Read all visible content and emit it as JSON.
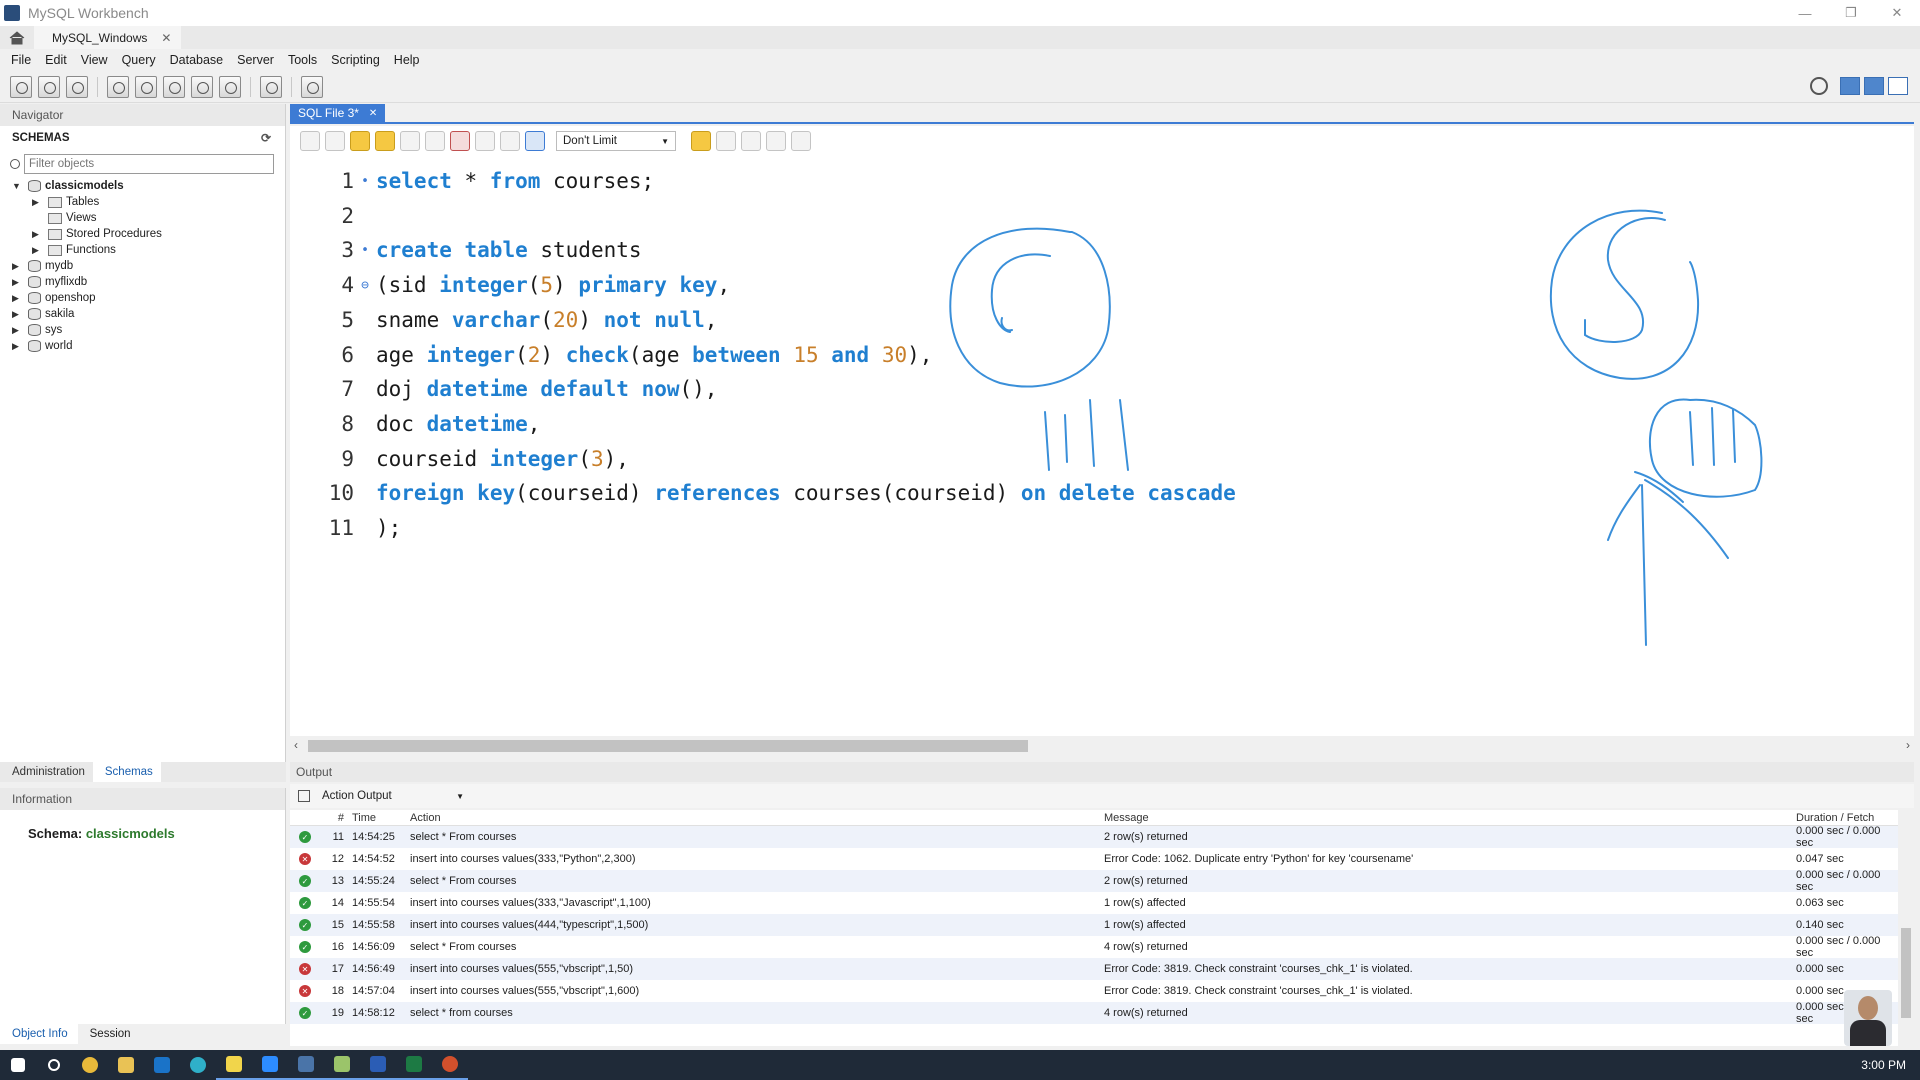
{
  "window": {
    "title": "MySQL Workbench",
    "minimize": "—",
    "restore": "❐",
    "close": "✕"
  },
  "connection_tab": {
    "label": "MySQL_Windows",
    "close": "✕"
  },
  "menu": [
    "File",
    "Edit",
    "View",
    "Query",
    "Database",
    "Server",
    "Tools",
    "Scripting",
    "Help"
  ],
  "navigator": {
    "title": "Navigator",
    "schemas_label": "SCHEMAS",
    "filter_placeholder": "Filter objects",
    "tree": [
      {
        "name": "classicmodels",
        "expanded": true,
        "children": [
          "Tables",
          "Views",
          "Stored Procedures",
          "Functions"
        ]
      },
      {
        "name": "mydb"
      },
      {
        "name": "myflixdb"
      },
      {
        "name": "openshop"
      },
      {
        "name": "sakila"
      },
      {
        "name": "sys"
      },
      {
        "name": "world"
      }
    ]
  },
  "admin_tabs": [
    "Administration",
    "Schemas"
  ],
  "information": {
    "title": "Information",
    "schema_label": "Schema:",
    "schema_value": "classicmodels"
  },
  "bottom_tabs": [
    "Object Info",
    "Session"
  ],
  "editor": {
    "tab_label": "SQL File 3*",
    "tab_close": "✕",
    "limit": "Don't Limit",
    "lines": [
      {
        "n": "1",
        "marker": "•",
        "text": "select * from courses;"
      },
      {
        "n": "2",
        "marker": "",
        "text": ""
      },
      {
        "n": "3",
        "marker": "•",
        "text": "create table students"
      },
      {
        "n": "4",
        "marker": "⊖",
        "text": "(sid integer(5) primary key,"
      },
      {
        "n": "5",
        "marker": "",
        "text": "sname varchar(20) not null,"
      },
      {
        "n": "6",
        "marker": "",
        "text": "age integer(2) check(age between 15 and 30),"
      },
      {
        "n": "7",
        "marker": "",
        "text": "doj datetime default now(),"
      },
      {
        "n": "8",
        "marker": "",
        "text": "doc datetime,"
      },
      {
        "n": "9",
        "marker": "",
        "text": "courseid integer(3),"
      },
      {
        "n": "10",
        "marker": "",
        "text": "foreign key(courseid) references courses(courseid) on delete cascade"
      },
      {
        "n": "11",
        "marker": "",
        "text": ");"
      }
    ]
  },
  "output": {
    "title": "Output",
    "selector": "Action Output",
    "columns": [
      "#",
      "Time",
      "Action",
      "Message",
      "Duration / Fetch"
    ],
    "rows": [
      {
        "status": "ok",
        "n": "11",
        "time": "14:54:25",
        "action": "select * From courses",
        "message": "2 row(s) returned",
        "duration": "0.000 sec / 0.000 sec"
      },
      {
        "status": "error",
        "n": "12",
        "time": "14:54:52",
        "action": "insert into courses values(333,\"Python\",2,300)",
        "message": "Error Code: 1062. Duplicate entry 'Python' for key 'coursename'",
        "duration": "0.047 sec"
      },
      {
        "status": "ok",
        "n": "13",
        "time": "14:55:24",
        "action": "select * From courses",
        "message": "2 row(s) returned",
        "duration": "0.000 sec / 0.000 sec"
      },
      {
        "status": "ok",
        "n": "14",
        "time": "14:55:54",
        "action": "insert into courses values(333,\"Javascript\",1,100)",
        "message": "1 row(s) affected",
        "duration": "0.063 sec"
      },
      {
        "status": "ok",
        "n": "15",
        "time": "14:55:58",
        "action": "insert into courses values(444,\"typescript\",1,500)",
        "message": "1 row(s) affected",
        "duration": "0.140 sec"
      },
      {
        "status": "ok",
        "n": "16",
        "time": "14:56:09",
        "action": "select * From courses",
        "message": "4 row(s) returned",
        "duration": "0.000 sec / 0.000 sec"
      },
      {
        "status": "error",
        "n": "17",
        "time": "14:56:49",
        "action": "insert into courses values(555,\"vbscript\",1,50)",
        "message": "Error Code: 3819. Check constraint 'courses_chk_1' is violated.",
        "duration": "0.000 sec"
      },
      {
        "status": "error",
        "n": "18",
        "time": "14:57:04",
        "action": "insert into courses values(555,\"vbscript\",1,600)",
        "message": "Error Code: 3819. Check constraint 'courses_chk_1' is violated.",
        "duration": "0.000 sec"
      },
      {
        "status": "ok",
        "n": "19",
        "time": "14:58:12",
        "action": "select * from courses",
        "message": "4 row(s) returned",
        "duration": "0.000 sec / 0.000 sec"
      }
    ]
  },
  "taskbar": {
    "clock": "3:00 PM"
  },
  "colors": {
    "keyword": "#1f7fd0",
    "number": "#c87f2a",
    "ink": "#3a8fd9",
    "accent": "#3d7bd4"
  }
}
